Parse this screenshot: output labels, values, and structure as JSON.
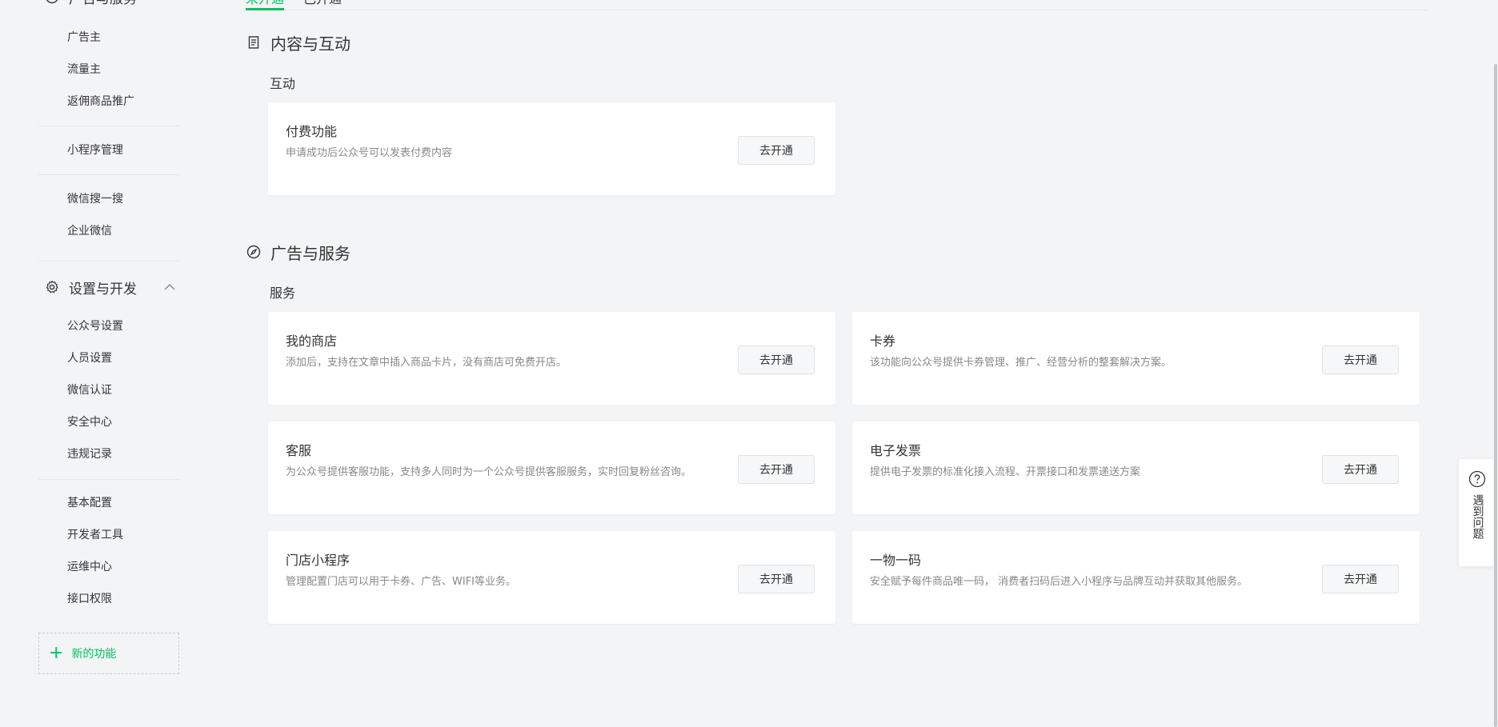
{
  "sidebar": {
    "header_label": "广告与服务",
    "items_top": [
      "广告主",
      "流量主",
      "返佣商品推广"
    ],
    "item_mini": "小程序管理",
    "items_mid": [
      "微信搜一搜",
      "企业微信"
    ],
    "group_label": "设置与开发",
    "group_items": [
      "公众号设置",
      "人员设置",
      "微信认证",
      "安全中心",
      "违规记录"
    ],
    "items_bottom": [
      "基本配置",
      "开发者工具",
      "运维中心",
      "接口权限"
    ],
    "new_feature_label": "新的功能"
  },
  "tabs": [
    "未开通",
    "已开通"
  ],
  "sections": [
    {
      "title": "内容与互动",
      "icon": "document-icon",
      "sub_title": "互动",
      "cards": [
        {
          "title": "付费功能",
          "desc": "申请成功后公众号可以发表付费内容",
          "button": "去开通"
        }
      ]
    },
    {
      "title": "广告与服务",
      "icon": "compass-icon",
      "sub_title": "服务",
      "cards": [
        {
          "title": "我的商店",
          "desc": "添加后，支持在文章中插入商品卡片，没有商店可免费开店。",
          "button": "去开通"
        },
        {
          "title": "卡券",
          "desc": "该功能向公众号提供卡券管理、推广、经营分析的整套解决方案。",
          "button": "去开通"
        },
        {
          "title": "客服",
          "desc": "为公众号提供客服功能，支持多人同时为一个公众号提供客服服务，实时回复粉丝咨询。",
          "button": "去开通"
        },
        {
          "title": "电子发票",
          "desc": "提供电子发票的标准化接入流程、开票接口和发票递送方案",
          "button": "去开通"
        },
        {
          "title": "门店小程序",
          "desc": "管理配置门店可以用于卡券、广告、WIFI等业务。",
          "button": "去开通"
        },
        {
          "title": "一物一码",
          "desc": "安全赋予每件商品唯一码， 消费者扫码后进入小程序与品牌互动并获取其他服务。",
          "button": "去开通"
        }
      ]
    }
  ],
  "help": {
    "label": "遇到问题"
  },
  "colors": {
    "accent": "#07c160",
    "background": "#f3f4f6",
    "card": "#ffffff"
  }
}
